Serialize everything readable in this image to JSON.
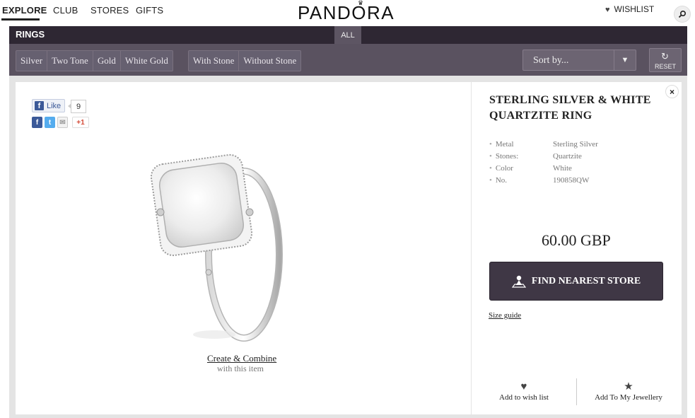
{
  "nav": {
    "items": [
      "EXPLORE",
      "CLUB",
      "STORES",
      "GIFTS"
    ],
    "logo": "PANDORA",
    "wishlist": "WISHLIST"
  },
  "category": {
    "title": "RINGS",
    "all_tab": "ALL"
  },
  "filters": {
    "material": [
      "Silver",
      "Two Tone",
      "Gold",
      "White Gold"
    ],
    "stone": [
      "With Stone",
      "Without Stone"
    ],
    "sort_label": "Sort by...",
    "reset_label": "RESET"
  },
  "social": {
    "like_label": "Like",
    "like_count": "9",
    "gplus_label": "+1"
  },
  "product": {
    "title": "STERLING SILVER & WHITE QUARTZITE RING",
    "specs": [
      {
        "label": "Metal",
        "value": "Sterling Silver"
      },
      {
        "label": "Stones:",
        "value": "Quartzite"
      },
      {
        "label": "Color",
        "value": "White"
      },
      {
        "label": "No.",
        "value": "190858QW"
      }
    ],
    "price": "60.00 GBP",
    "store_button": "FIND NEAREST STORE",
    "size_guide": "Size guide",
    "create_link": "Create & Combine",
    "create_sub": "with this item",
    "add_wishlist": "Add to wish list",
    "add_jewellery": "Add To My Jewellery",
    "close": "×"
  },
  "colors": {
    "header_dark": "#2e2733",
    "filter_bar": "#5a5260",
    "button_dark": "#3f3745"
  }
}
